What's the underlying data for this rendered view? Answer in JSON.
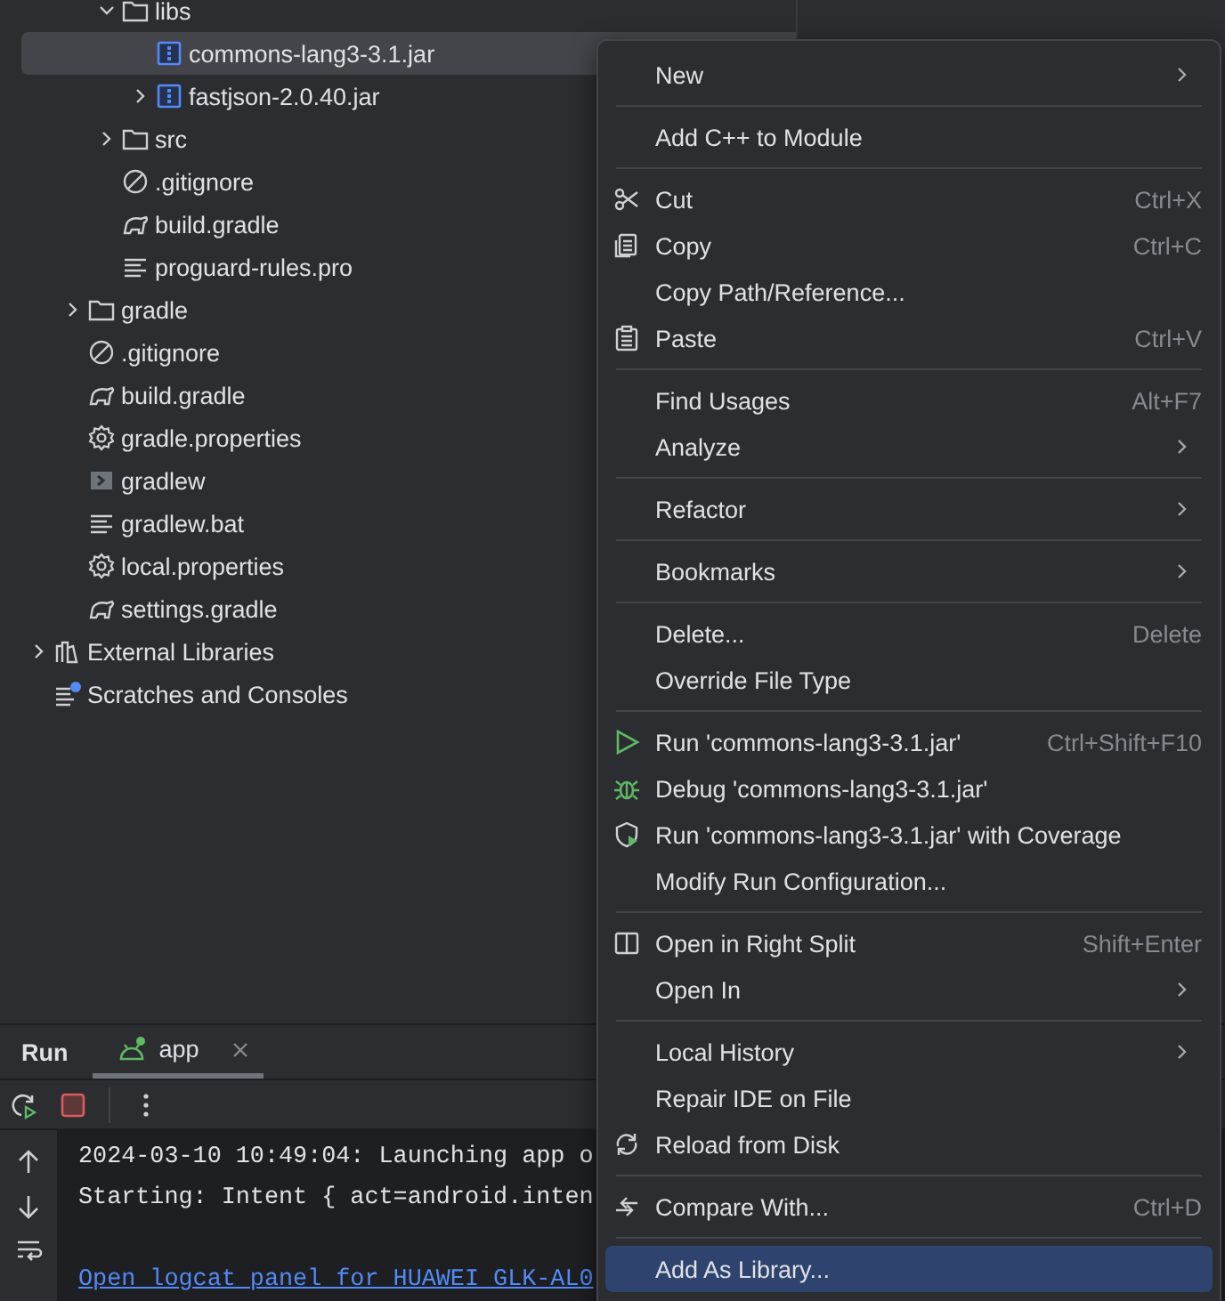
{
  "project_tree": [
    {
      "children": [
        {
          "children": [
            {
              "label": "libs",
              "kind": "folder",
              "expanded": true,
              "selected": false,
              "children": [
                {
                  "label": "commons-lang3-3.1.jar",
                  "kind": "jar",
                  "selected": true
                },
                {
                  "label": "fastjson-2.0.40.jar",
                  "kind": "jar",
                  "expanded": false,
                  "selected": false
                }
              ]
            },
            {
              "label": "src",
              "kind": "folder",
              "expanded": false,
              "selected": false
            },
            {
              "label": ".gitignore",
              "kind": "ignore",
              "selected": false
            },
            {
              "label": "build.gradle",
              "kind": "gradle",
              "selected": false
            },
            {
              "label": "proguard-rules.pro",
              "kind": "text",
              "selected": false
            }
          ]
        },
        {
          "label": "gradle",
          "kind": "folder",
          "expanded": false,
          "selected": false
        },
        {
          "label": ".gitignore",
          "kind": "ignore",
          "selected": false
        },
        {
          "label": "build.gradle",
          "kind": "gradle",
          "selected": false
        },
        {
          "label": "gradle.properties",
          "kind": "properties",
          "selected": false
        },
        {
          "label": "gradlew",
          "kind": "script",
          "selected": false
        },
        {
          "label": "gradlew.bat",
          "kind": "text",
          "selected": false
        },
        {
          "label": "local.properties",
          "kind": "properties",
          "selected": false
        },
        {
          "label": "settings.gradle",
          "kind": "gradle",
          "selected": false
        }
      ]
    },
    {
      "label": "External Libraries",
      "kind": "library",
      "expanded": false,
      "selected": false
    },
    {
      "label": "Scratches and Consoles",
      "kind": "scratches",
      "selected": false
    }
  ],
  "run_panel": {
    "title": "Run",
    "tabs": [
      {
        "label": "app",
        "selected": true
      }
    ],
    "console_lines": [
      {
        "kind": "text",
        "text": "2024-03-10 10:49:04: Launching app o"
      },
      {
        "kind": "text",
        "text": "Starting: Intent { act=android.inten"
      },
      {
        "kind": "blank"
      },
      {
        "kind": "link",
        "text": "Open logcat panel for HUAWEI GLK-AL0"
      }
    ]
  },
  "context_menu": [
    [
      {
        "label": "New",
        "kind": "submenu",
        "selected": false
      }
    ],
    [
      {
        "label": "Add C++ to Module",
        "kind": "plain",
        "selected": false
      }
    ],
    [
      {
        "label": "Cut",
        "kind": "cut",
        "shortcut": "Ctrl+X",
        "selected": false
      },
      {
        "label": "Copy",
        "kind": "copy",
        "shortcut": "Ctrl+C",
        "selected": false
      },
      {
        "label": "Copy Path/Reference...",
        "kind": "plain",
        "selected": false
      },
      {
        "label": "Paste",
        "kind": "paste",
        "shortcut": "Ctrl+V",
        "selected": false
      }
    ],
    [
      {
        "label": "Find Usages",
        "kind": "plain",
        "shortcut": "Alt+F7",
        "selected": false
      },
      {
        "label": "Analyze",
        "kind": "submenu",
        "selected": false
      }
    ],
    [
      {
        "label": "Refactor",
        "kind": "submenu",
        "selected": false
      }
    ],
    [
      {
        "label": "Bookmarks",
        "kind": "submenu",
        "selected": false
      }
    ],
    [
      {
        "label": "Delete...",
        "kind": "plain",
        "shortcut": "Delete",
        "selected": false
      },
      {
        "label": "Override File Type",
        "kind": "plain",
        "selected": false
      }
    ],
    [
      {
        "label": "Run 'commons-lang3-3.1.jar'",
        "kind": "run",
        "shortcut": "Ctrl+Shift+F10",
        "selected": false
      },
      {
        "label": "Debug 'commons-lang3-3.1.jar'",
        "kind": "debug",
        "selected": false
      },
      {
        "label": "Run 'commons-lang3-3.1.jar' with Coverage",
        "kind": "coverage",
        "selected": false
      },
      {
        "label": "Modify Run Configuration...",
        "kind": "plain",
        "selected": false
      }
    ],
    [
      {
        "label": "Open in Right Split",
        "kind": "split",
        "shortcut": "Shift+Enter",
        "selected": false
      },
      {
        "label": "Open In",
        "kind": "submenu",
        "selected": false
      }
    ],
    [
      {
        "label": "Local History",
        "kind": "submenu",
        "selected": false
      },
      {
        "label": "Repair IDE on File",
        "kind": "plain",
        "selected": false
      },
      {
        "label": "Reload from Disk",
        "kind": "reload",
        "selected": false
      }
    ],
    [
      {
        "label": "Compare With...",
        "kind": "compare",
        "shortcut": "Ctrl+D",
        "selected": false
      }
    ],
    [
      {
        "label": "Add As Library...",
        "kind": "plain",
        "selected": true
      }
    ]
  ]
}
